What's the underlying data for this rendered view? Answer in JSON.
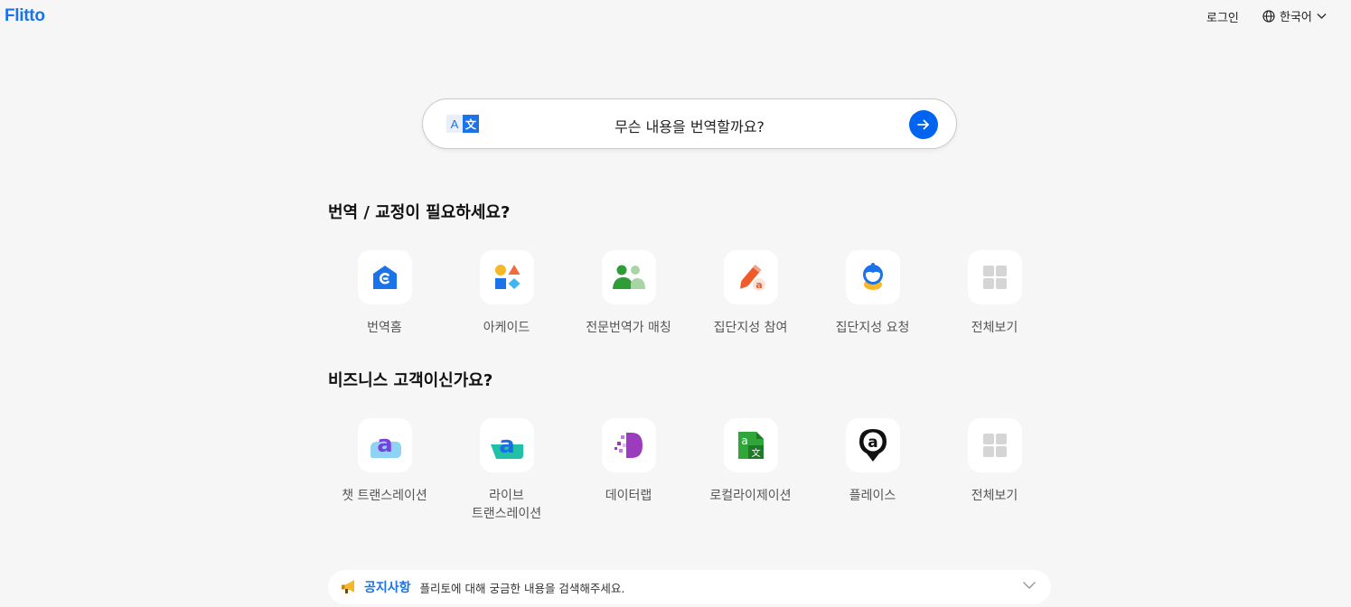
{
  "header": {
    "logo": "Flitto",
    "login_label": "로그인",
    "language_label": "한국어"
  },
  "search": {
    "placeholder": "무슨 내용을 번역할까요?",
    "icon_left": "A",
    "icon_right": "文"
  },
  "translation_section": {
    "title": "번역 / 교정이 필요하세요?",
    "items": [
      {
        "label": "번역홈",
        "icon": "translation-home-icon"
      },
      {
        "label": "아케이드",
        "icon": "arcade-icon"
      },
      {
        "label": "전문번역가 매칭",
        "icon": "expert-matching-icon"
      },
      {
        "label": "집단지성 참여",
        "icon": "crowd-participate-icon"
      },
      {
        "label": "집단지성 요청",
        "icon": "crowd-request-icon"
      },
      {
        "label": "전체보기",
        "icon": "view-all-icon"
      }
    ]
  },
  "business_section": {
    "title": "비즈니스 고객이신가요?",
    "items": [
      {
        "label": "챗 트랜스레이션",
        "icon": "chat-translation-icon",
        "glyph": "a"
      },
      {
        "label": "라이브\n트랜스레이션",
        "icon": "live-translation-icon",
        "glyph": "a"
      },
      {
        "label": "데이터랩",
        "icon": "datalab-icon"
      },
      {
        "label": "로컬라이제이션",
        "icon": "localization-icon",
        "glyph": "a",
        "glyph2": "文"
      },
      {
        "label": "플레이스",
        "icon": "place-icon",
        "glyph": "a"
      },
      {
        "label": "전체보기",
        "icon": "view-all-icon"
      }
    ]
  },
  "notice": {
    "title": "공지사항",
    "text": "플리토에 대해 궁금한 내용을 검색해주세요."
  },
  "colors": {
    "brand": "#1a73e8",
    "action": "#0064f0",
    "background": "#f6f6f6"
  }
}
